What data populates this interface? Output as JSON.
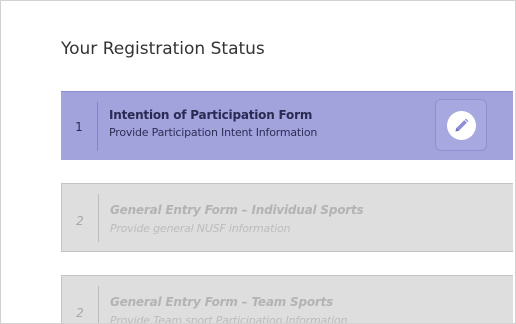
{
  "page": {
    "title": "Your Registration Status"
  },
  "steps": [
    {
      "number": "1",
      "title": "Intention of Participation Form",
      "subtitle": "Provide Participation Intent Information",
      "state": "active",
      "action_icon": "pencil-icon"
    },
    {
      "number": "2",
      "title": "General Entry Form – Individual Sports",
      "subtitle": "Provide general NUSF information",
      "state": "disabled"
    },
    {
      "number": "2",
      "title": "General Entry Form – Team Sports",
      "subtitle": "Provide Team sport Participation Information",
      "state": "disabled"
    }
  ],
  "colors": {
    "active_bg": "#a2a2dd",
    "disabled_bg": "#dedede",
    "active_text": "#2a2a52",
    "disabled_text": "#b3b3b3"
  }
}
